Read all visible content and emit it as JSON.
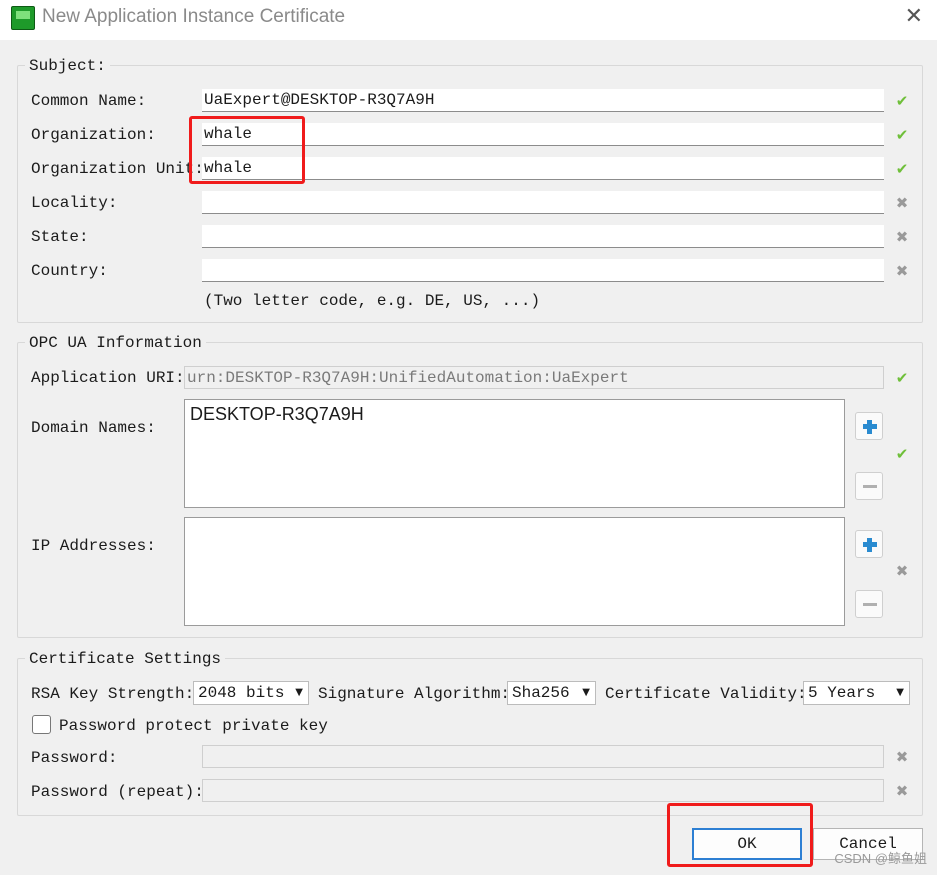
{
  "window": {
    "title": "New Application Instance Certificate"
  },
  "subject": {
    "group_title": "Subject:",
    "common_name": {
      "label": "Common Name:",
      "value": "UaExpert@DESKTOP-R3Q7A9H",
      "status": "valid"
    },
    "organization": {
      "label": "Organization:",
      "value": "whale",
      "status": "valid"
    },
    "organization_unit": {
      "label": "Organization Unit:",
      "value": "whale",
      "status": "valid"
    },
    "locality": {
      "label": "Locality:",
      "value": "",
      "status": "invalid"
    },
    "state": {
      "label": "State:",
      "value": "",
      "status": "invalid"
    },
    "country": {
      "label": "Country:",
      "value": "",
      "status": "invalid"
    },
    "country_hint": "(Two letter code, e.g. DE, US, ...)"
  },
  "opc": {
    "group_title": "OPC UA Information",
    "application_uri": {
      "label": "Application URI:",
      "value": "urn:DESKTOP-R3Q7A9H:UnifiedAutomation:UaExpert"
    },
    "domain_names": {
      "label": "Domain Names:",
      "value": "DESKTOP-R3Q7A9H"
    },
    "ip_addresses": {
      "label": "IP Addresses:",
      "value": ""
    }
  },
  "cert": {
    "group_title": "Certificate Settings",
    "rsa_label": "RSA Key Strength:",
    "rsa_value": "2048 bits",
    "sig_label": "Signature Algorithm:",
    "sig_value": "Sha256",
    "validity_label": "Certificate Validity:",
    "validity_value": "5 Years",
    "password_protect_label": "Password protect private key",
    "password_protect_checked": false,
    "password_label": "Password:",
    "password_repeat_label": "Password (repeat):"
  },
  "buttons": {
    "ok": "OK",
    "cancel": "Cancel"
  },
  "icons": {
    "valid": "check-icon",
    "invalid": "cross-icon",
    "add": "plus-icon",
    "remove": "minus-icon"
  },
  "colors": {
    "valid": "#6fbf3a",
    "highlight": "#f01b1b",
    "default_button": "#2d7fd3",
    "add_icon": "#2a8bd0"
  },
  "watermark": "CSDN @鲸鱼姐"
}
